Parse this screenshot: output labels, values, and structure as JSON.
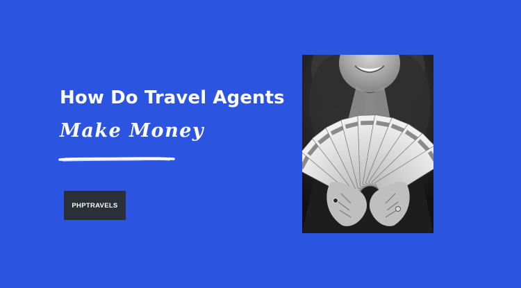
{
  "banner": {
    "title": "How Do Travel Agents",
    "subtitle": "Make Money",
    "brand": "PHPTRAVELS",
    "colors": {
      "background": "#2b55e0",
      "badge": "#2a2f38",
      "text": "#ffffff"
    }
  },
  "photo": {
    "description_icon": "person-holding-cash-fan-photo"
  }
}
